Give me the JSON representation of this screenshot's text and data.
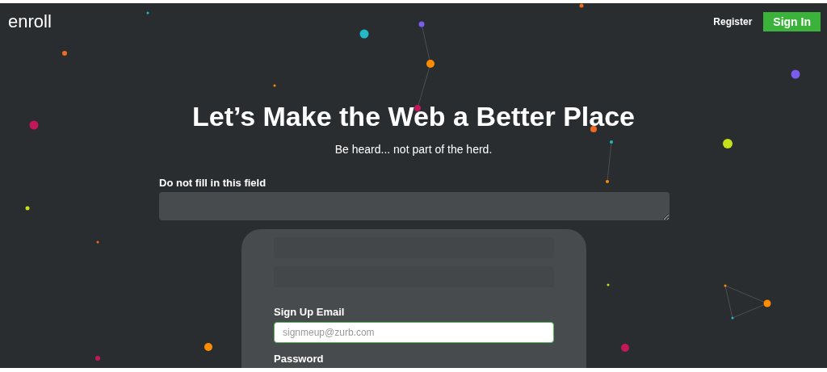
{
  "header": {
    "logo": "enroll",
    "links": [
      {
        "label": "Register",
        "kind": "link"
      },
      {
        "label": "Sign In",
        "kind": "button"
      }
    ]
  },
  "hero": {
    "title": "Let’s Make the Web a Better Place",
    "subtitle": "Be heard... not part of the herd."
  },
  "honeypot": {
    "label": "Do not fill in this field"
  },
  "form": {
    "blank_fields": [
      {
        "kind": "empty"
      },
      {
        "kind": "empty"
      }
    ],
    "email": {
      "label": "Sign Up Email",
      "placeholder": "signmeup@zurb.com"
    },
    "password": {
      "label": "Password"
    }
  }
}
